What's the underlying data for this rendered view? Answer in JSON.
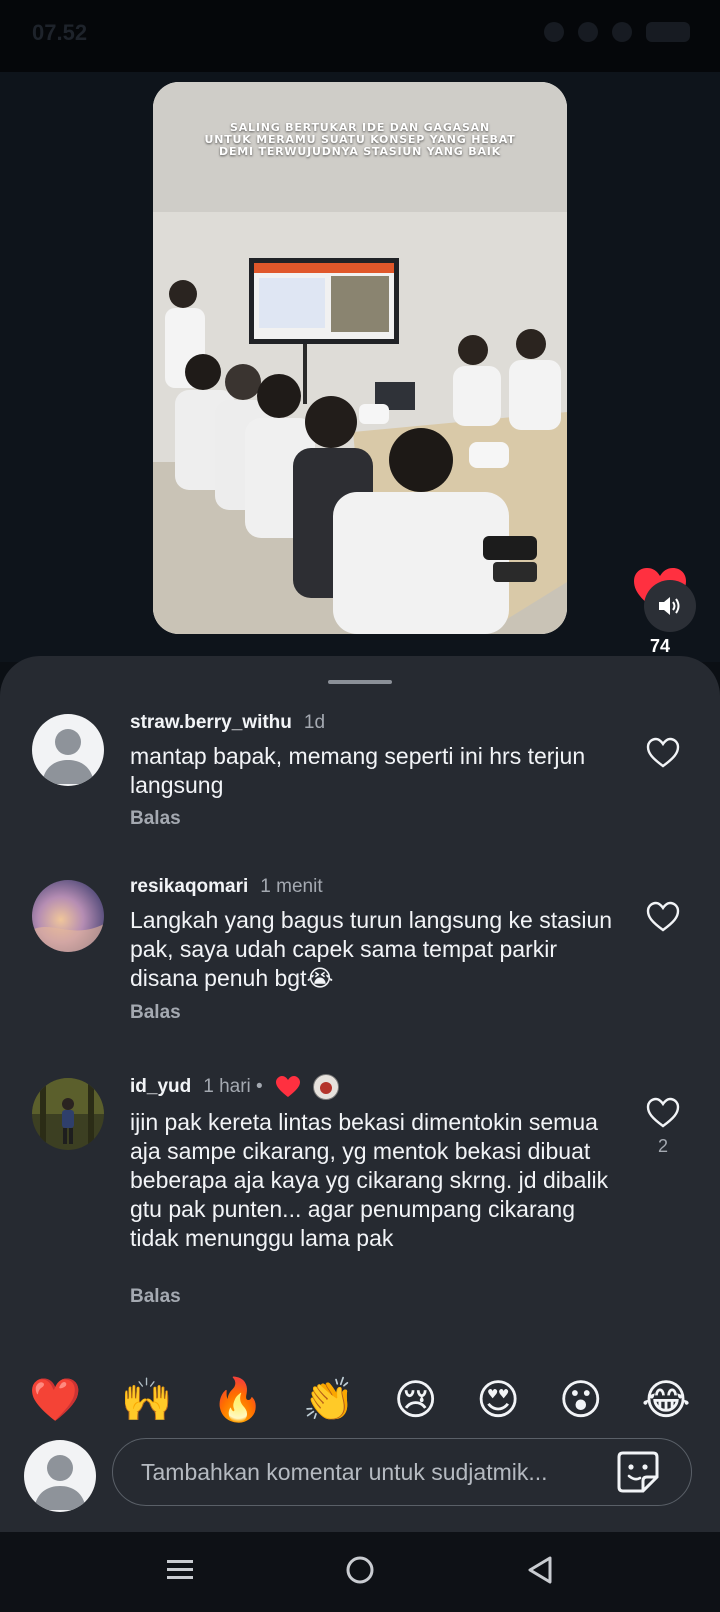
{
  "status_bar": {
    "time": "07.52"
  },
  "video": {
    "caption": "SALING BERTUKAR IDE DAN GAGASAN\nUNTUK MERAMU SUATU KONSEP YANG HEBAT\nDEMI TERWUJUDNYA STASIUN YANG BAIK"
  },
  "post": {
    "like_count": "74",
    "heart_icon": "heart-filled-icon",
    "sound_icon": "speaker-icon"
  },
  "comments": [
    {
      "username": "straw.berry_withu",
      "time": "1d",
      "text": "mantap bapak, memang seperti ini hrs terjun langsung",
      "reply_label": "Balas",
      "like_count": ""
    },
    {
      "username": "resikaqomari",
      "time": "1 menit",
      "text": "Langkah yang bagus turun langsung ke stasiun pak, saya udah capek sama tempat parkir disana penuh bgt😭",
      "reply_label": "Balas",
      "like_count": ""
    },
    {
      "username": "id_yud",
      "time": "1 hari •",
      "text": "ijin pak kereta lintas bekasi dimentokin semua aja sampe cikarang, yg mentok bekasi dibuat beberapa aja kaya yg cikarang skrng. jd dibalik gtu pak punten... agar penumpang cikarang tidak menunggu lama pak",
      "reply_label": "Balas",
      "like_count": "2"
    }
  ],
  "emoji_bar": [
    "❤️",
    "🙌",
    "🔥",
    "👏",
    "😢",
    "😍",
    "😮",
    "😂"
  ],
  "composer": {
    "placeholder": "Tambahkan komentar untuk sudjatmik...",
    "sticker_icon": "sticker-icon"
  },
  "nav": {
    "recents_icon": "menu-lines-icon",
    "home_icon": "circle-home-icon",
    "back_icon": "triangle-back-icon"
  },
  "colors": {
    "background": "#0e141b",
    "sheet": "#262a31",
    "like_red": "#ff3040",
    "secondary_text": "#a4a9b1"
  }
}
